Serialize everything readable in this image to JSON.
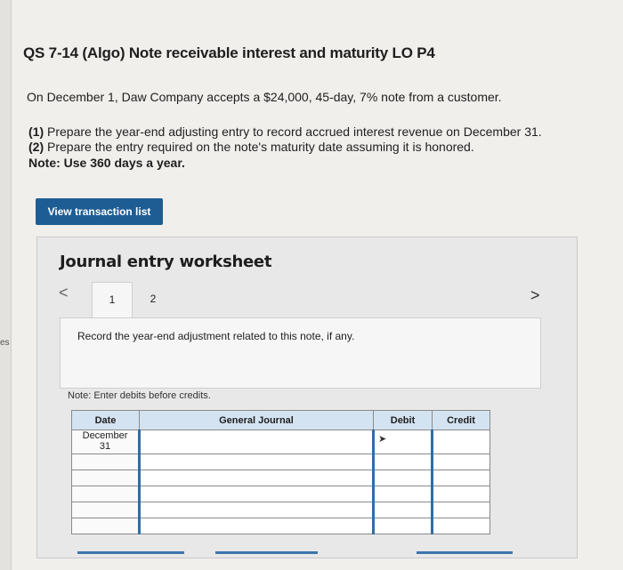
{
  "sidebar_fragment": "es",
  "title": "QS 7-14 (Algo) Note receivable interest and maturity LO P4",
  "intro": "On December 1, Daw Company accepts a $24,000, 45-day, 7% note from a customer.",
  "requirements": [
    {
      "num": "(1)",
      "text": " Prepare the year-end adjusting entry to record accrued interest revenue on December 31."
    },
    {
      "num": "(2)",
      "text": " Prepare the entry required on the note's maturity date assuming it is honored."
    }
  ],
  "note": "Note: Use 360 days a year.",
  "view_button": "View transaction list",
  "worksheet": {
    "title": "Journal entry worksheet",
    "prev": "<",
    "next": ">",
    "tabs": [
      "1",
      "2"
    ],
    "active_tab": "1",
    "instruction": "Record the year-end adjustment related to this note, if any.",
    "entry_note": "Note: Enter debits before credits.",
    "table": {
      "headers": {
        "date": "Date",
        "account": "General Journal",
        "debit": "Debit",
        "credit": "Credit"
      },
      "first_date_month": "December",
      "first_date_day": "31",
      "rows": 6
    }
  },
  "colors": {
    "button": "#1e5d93",
    "header": "#d4e3f2",
    "accent": "#2f6ea5"
  }
}
